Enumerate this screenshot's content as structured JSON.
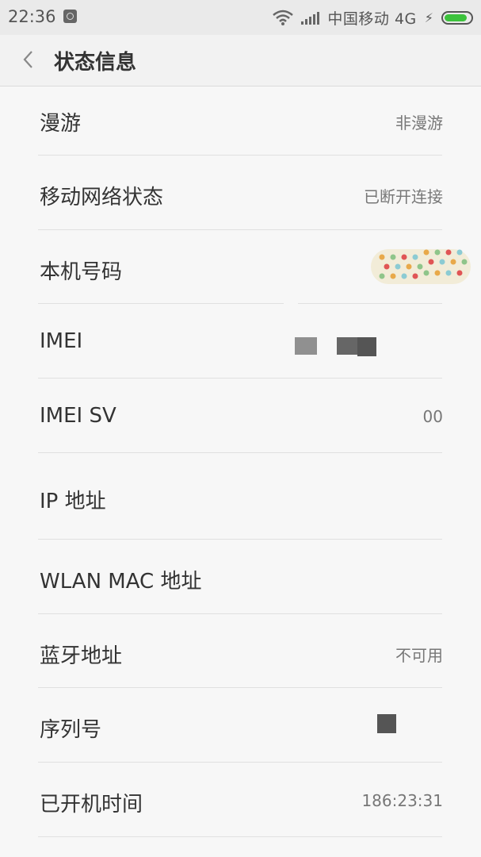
{
  "status_bar": {
    "time": "22:36",
    "carrier": "中国移动 4G",
    "battery_color": "#3cc23c"
  },
  "header": {
    "title": "状态信息",
    "back_icon": "chevron-left-icon"
  },
  "rows": [
    {
      "label": "漫游",
      "value": "非漫游"
    },
    {
      "label": "移动网络状态",
      "value": "已断开连接"
    },
    {
      "label": "本机号码",
      "value": ""
    },
    {
      "label": "IMEI",
      "value": ""
    },
    {
      "label": "IMEI SV",
      "value": "00"
    },
    {
      "label": "IP 地址",
      "value": ""
    },
    {
      "label": "WLAN MAC 地址",
      "value": ""
    },
    {
      "label": "蓝牙地址",
      "value": "不可用"
    },
    {
      "label": "序列号",
      "value": ""
    },
    {
      "label": "已开机时间",
      "value": "186:23:31"
    }
  ]
}
